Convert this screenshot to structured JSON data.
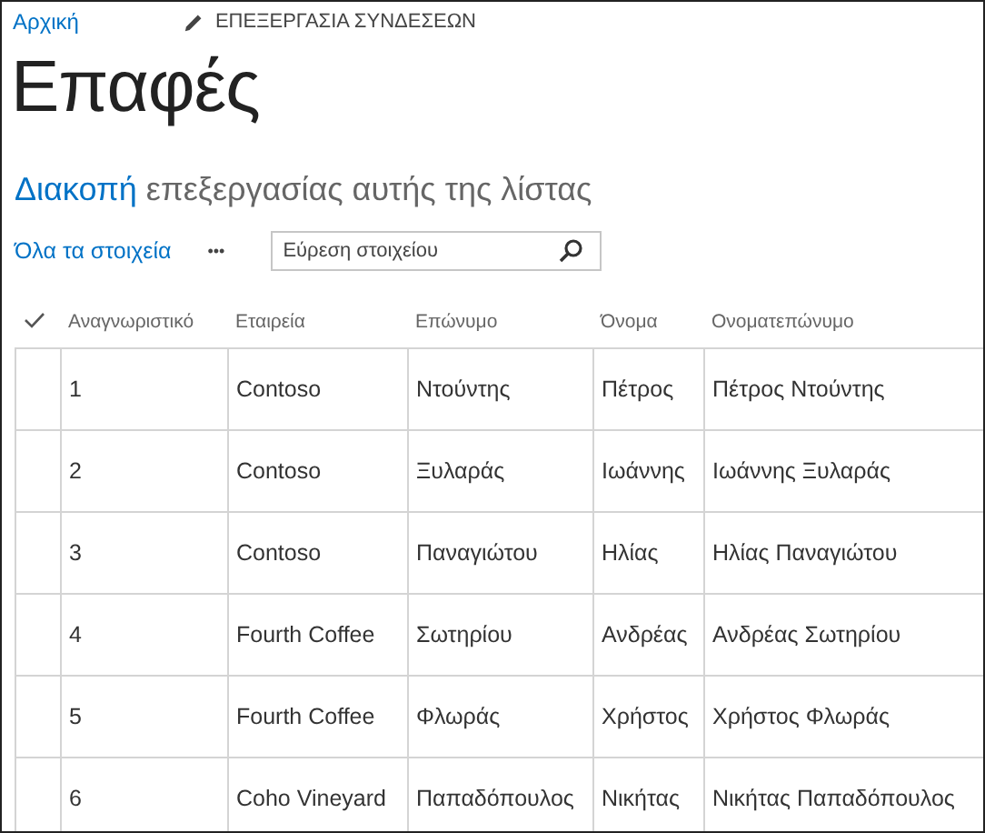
{
  "top_bar": {
    "home_link": "Αρχική",
    "edit_links": "ΕΠΕΞΕΡΓΑΣΙΑ ΣΥΝΔΕΣΕΩΝ"
  },
  "page_title": "Επαφές",
  "edit_banner": {
    "link": "Διακοπή",
    "text": "επεξεργασίας αυτής της λίστας"
  },
  "toolbar": {
    "view": "Όλα τα στοιχεία",
    "more": "•••",
    "search": {
      "placeholder": "Εύρεση στοιχείου"
    }
  },
  "table": {
    "columns": [
      "Αναγνωριστικό",
      "Εταιρεία",
      "Επώνυμο",
      "Όνομα",
      "Ονοματεπώνυμο"
    ],
    "rows": [
      [
        "1",
        "Contoso",
        "Ντούντης",
        "Πέτρος",
        "Πέτρος Ντούντης"
      ],
      [
        "2",
        "Contoso",
        "Ξυλαράς",
        "Ιωάννης",
        "Ιωάννης Ξυλαράς"
      ],
      [
        "3",
        "Contoso",
        "Παναγιώτου",
        "Ηλίας",
        "Ηλίας Παναγιώτου"
      ],
      [
        "4",
        "Fourth Coffee",
        "Σωτηρίου",
        "Ανδρέας",
        "Ανδρέας Σωτηρίου"
      ],
      [
        "5",
        "Fourth Coffee",
        "Φλωράς",
        "Χρήστος",
        "Χρήστος Φλωράς"
      ],
      [
        "6",
        "Coho Vineyard",
        "Παπαδόπουλος",
        "Νικήτας",
        "Νικήτας Παπαδόπουλος"
      ]
    ]
  }
}
